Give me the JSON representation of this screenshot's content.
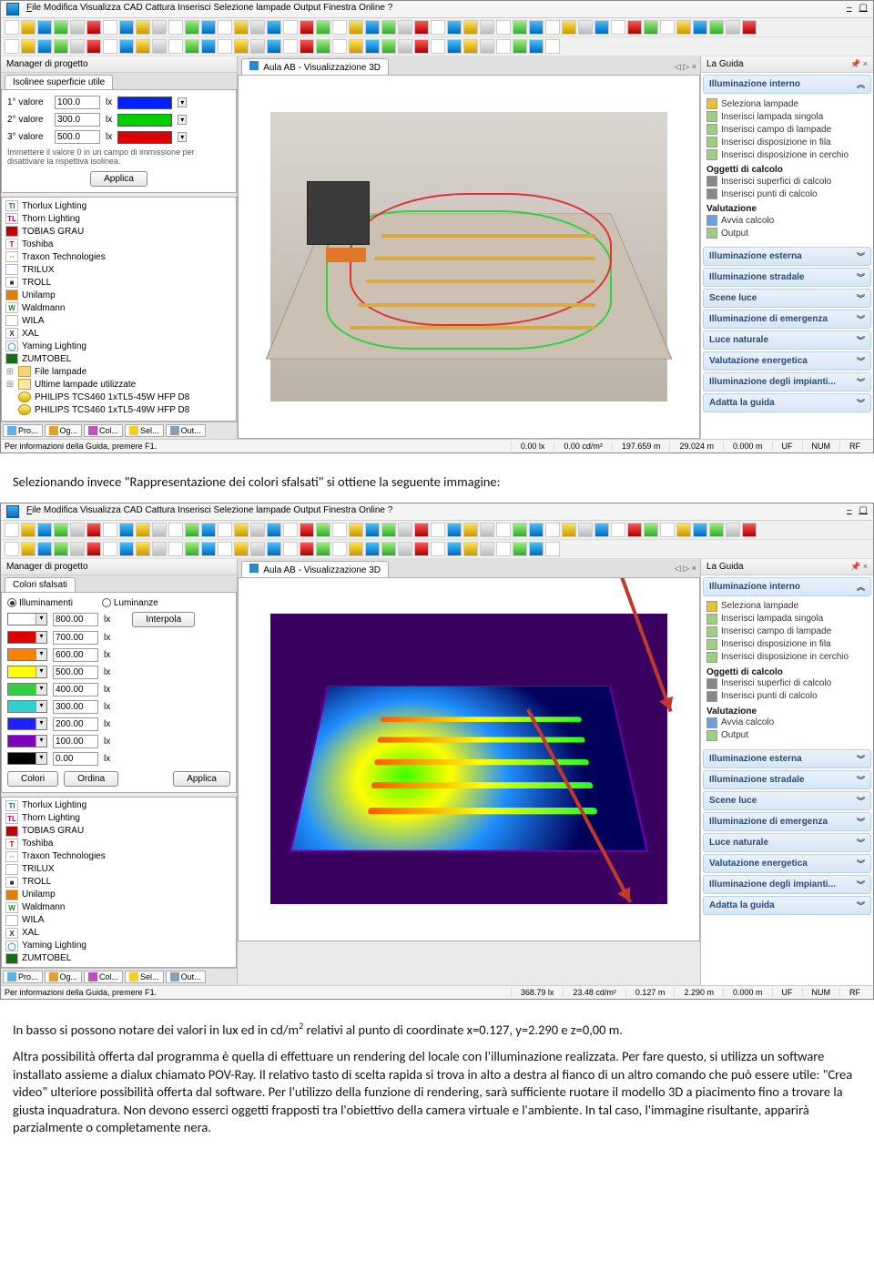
{
  "menubar": [
    "File",
    "Modifica",
    "Visualizza",
    "CAD",
    "Cattura",
    "Inserisci",
    "Selezione lampade",
    "Output",
    "Finestra",
    "Online",
    "?"
  ],
  "status_common": {
    "help": "Per informazioni della Guida, premere F1.",
    "uf": "UF",
    "num": "NUM",
    "rf": "RF"
  },
  "app1": {
    "project_manager_title": "Manager di progetto",
    "view_tab": "Aula AB - Visualizzazione 3D",
    "guide_title": "La Guida",
    "panel_tab": "Isolinee superficie utile",
    "rows": [
      {
        "label": "1° valore",
        "value": "100.0",
        "unit": "lx",
        "color": "#0020ff"
      },
      {
        "label": "2° valore",
        "value": "300.0",
        "unit": "lx",
        "color": "#00d000"
      },
      {
        "label": "3° valore",
        "value": "500.0",
        "unit": "lx",
        "color": "#e00000"
      }
    ],
    "hint": "Immettere il valore 0 in un campo di immissione per disattivare la rispettiva isolinea.",
    "apply": "Applica",
    "status": {
      "lx": "0.00 lx",
      "cdm2": "0.00 cd/m²",
      "m1": "197.659 m",
      "m2": "29.024 m",
      "m3": "0.000 m"
    }
  },
  "app2": {
    "panel_tab": "Colori sfalsati",
    "radio_ill": "Illuminamenti",
    "radio_lum": "Luminanze",
    "interpola": "Interpola",
    "apply": "Applica",
    "colori": "Colori",
    "ordina": "Ordina",
    "rows": [
      {
        "color": "#ffffff",
        "value": "800.00",
        "unit": "lx"
      },
      {
        "color": "#e00000",
        "value": "700.00",
        "unit": "lx"
      },
      {
        "color": "#ff8000",
        "value": "600.00",
        "unit": "lx"
      },
      {
        "color": "#ffff00",
        "value": "500.00",
        "unit": "lx"
      },
      {
        "color": "#30d040",
        "value": "400.00",
        "unit": "lx"
      },
      {
        "color": "#30d0d0",
        "value": "300.00",
        "unit": "lx"
      },
      {
        "color": "#2020ff",
        "value": "200.00",
        "unit": "lx"
      },
      {
        "color": "#8000c0",
        "value": "100.00",
        "unit": "lx"
      },
      {
        "color": "#000000",
        "value": "0.00",
        "unit": "lx"
      }
    ],
    "status": {
      "lx": "368.79 lx",
      "cdm2": "23.48 cd/m²",
      "m1": "0.127 m",
      "m2": "2.290 m",
      "m3": "0.000 m"
    }
  },
  "tree_items": [
    {
      "iconText": "TI",
      "iconBg": "#fff",
      "iconColor": "#1060b0",
      "label": "Thorlux Lighting"
    },
    {
      "iconText": "TL",
      "iconBg": "#fff",
      "iconColor": "#c00060",
      "label": "Thorn Lighting"
    },
    {
      "iconText": "",
      "iconBg": "#c00000",
      "iconColor": "#fff",
      "label": "TOBIAS GRAU"
    },
    {
      "iconText": "T",
      "iconBg": "#fff",
      "iconColor": "#c00000",
      "label": "Toshiba"
    },
    {
      "iconText": "⋅⋅",
      "iconBg": "#fff",
      "iconColor": "#e08000",
      "label": "Traxon Technologies"
    },
    {
      "iconText": "",
      "iconBg": "#fff",
      "iconColor": "#333",
      "label": "TRILUX"
    },
    {
      "iconText": "■",
      "iconBg": "#fff",
      "iconColor": "#333",
      "label": "TROLL"
    },
    {
      "iconText": "",
      "iconBg": "#e08000",
      "iconColor": "#fff",
      "label": "Unilamp"
    },
    {
      "iconText": "W",
      "iconBg": "#fff",
      "iconColor": "#2a7a2a",
      "label": "Waldmann"
    },
    {
      "iconText": "",
      "iconBg": "#fff",
      "iconColor": "#888",
      "label": "WILA"
    },
    {
      "iconText": "X",
      "iconBg": "#fff",
      "iconColor": "#333",
      "label": "XAL"
    },
    {
      "iconText": "◯",
      "iconBg": "#fff",
      "iconColor": "#2a8acc",
      "label": "Yaming Lighting"
    },
    {
      "iconText": "",
      "iconBg": "#1a6a1a",
      "iconColor": "#fff",
      "label": "ZUMTOBEL"
    }
  ],
  "tree_extra_app1": [
    {
      "label": "File lampade",
      "icon": "folder"
    },
    {
      "label": "Ultime lampade utilizzate",
      "icon": "folder-open"
    },
    {
      "label": "PHILIPS  TCS460 1xTL5-45W HFP D8",
      "icon": "lamp"
    },
    {
      "label": "PHILIPS  TCS460 1xTL5-49W HFP D8",
      "icon": "lamp"
    }
  ],
  "bottom_tabs": [
    {
      "label": "Pro...",
      "color": "#5bb3e6"
    },
    {
      "label": "Og...",
      "color": "#e6a02a"
    },
    {
      "label": "Col...",
      "color": "#c050c0"
    },
    {
      "label": "Sel...",
      "color": "#f5d020"
    },
    {
      "label": "Out...",
      "color": "#8aa0b0"
    }
  ],
  "guide": {
    "header_open": "Illuminazione interno",
    "links": [
      {
        "ico": "wand",
        "text": "Seleziona lampade"
      },
      {
        "ico": "page",
        "text": "Inserisci lampada singola"
      },
      {
        "ico": "page",
        "text": "Inserisci campo di lampade"
      },
      {
        "ico": "page",
        "text": "Inserisci disposizione in fila"
      },
      {
        "ico": "page",
        "text": "Inserisci disposizione in cerchio"
      }
    ],
    "sub1": "Oggetti di calcolo",
    "sub1_links": [
      {
        "ico": "grid",
        "text": "Inserisci superfici di calcolo"
      },
      {
        "ico": "point",
        "text": "Inserisci punti di calcolo"
      }
    ],
    "sub2": "Valutazione",
    "sub2_links": [
      {
        "ico": "play",
        "text": "Avvia calcolo"
      },
      {
        "ico": "out",
        "text": "Output"
      }
    ],
    "sections": [
      "Illuminazione esterna",
      "Illuminazione stradale",
      "Scene luce",
      "Illuminazione di emergenza",
      "Luce naturale",
      "Valutazione energetica",
      "Illuminazione degli impianti...",
      "Adatta la guida"
    ]
  },
  "doc": {
    "p1": "Selezionando invece \"Rappresentazione dei colori sfalsati\" si ottiene la seguente immagine:",
    "p2_a": "In basso si possono notare dei valori in lux ed in cd/m",
    "p2_b": " relativi al punto di coordinate x=0.127, y=2.290 e z=0,00 m.",
    "p3": "Altra possibilità offerta dal programma è quella di effettuare un rendering del locale con l'illuminazione realizzata. Per fare questo, si utilizza un software installato assieme a dialux chiamato POV-Ray. Il relativo tasto di scelta rapida si trova in alto a destra al fianco di un altro comando che può essere utile: \"Crea video\" ulteriore possibilità offerta dal software. Per l'utilizzo della funzione di rendering, sarà sufficiente ruotare il modello 3D a piacimento fino a trovare la giusta inquadratura. Non devono esserci oggetti frapposti tra l'obiettivo della camera virtuale e l'ambiente. In tal caso, l'immagine risultante, apparirà parzialmente o completamente nera."
  }
}
